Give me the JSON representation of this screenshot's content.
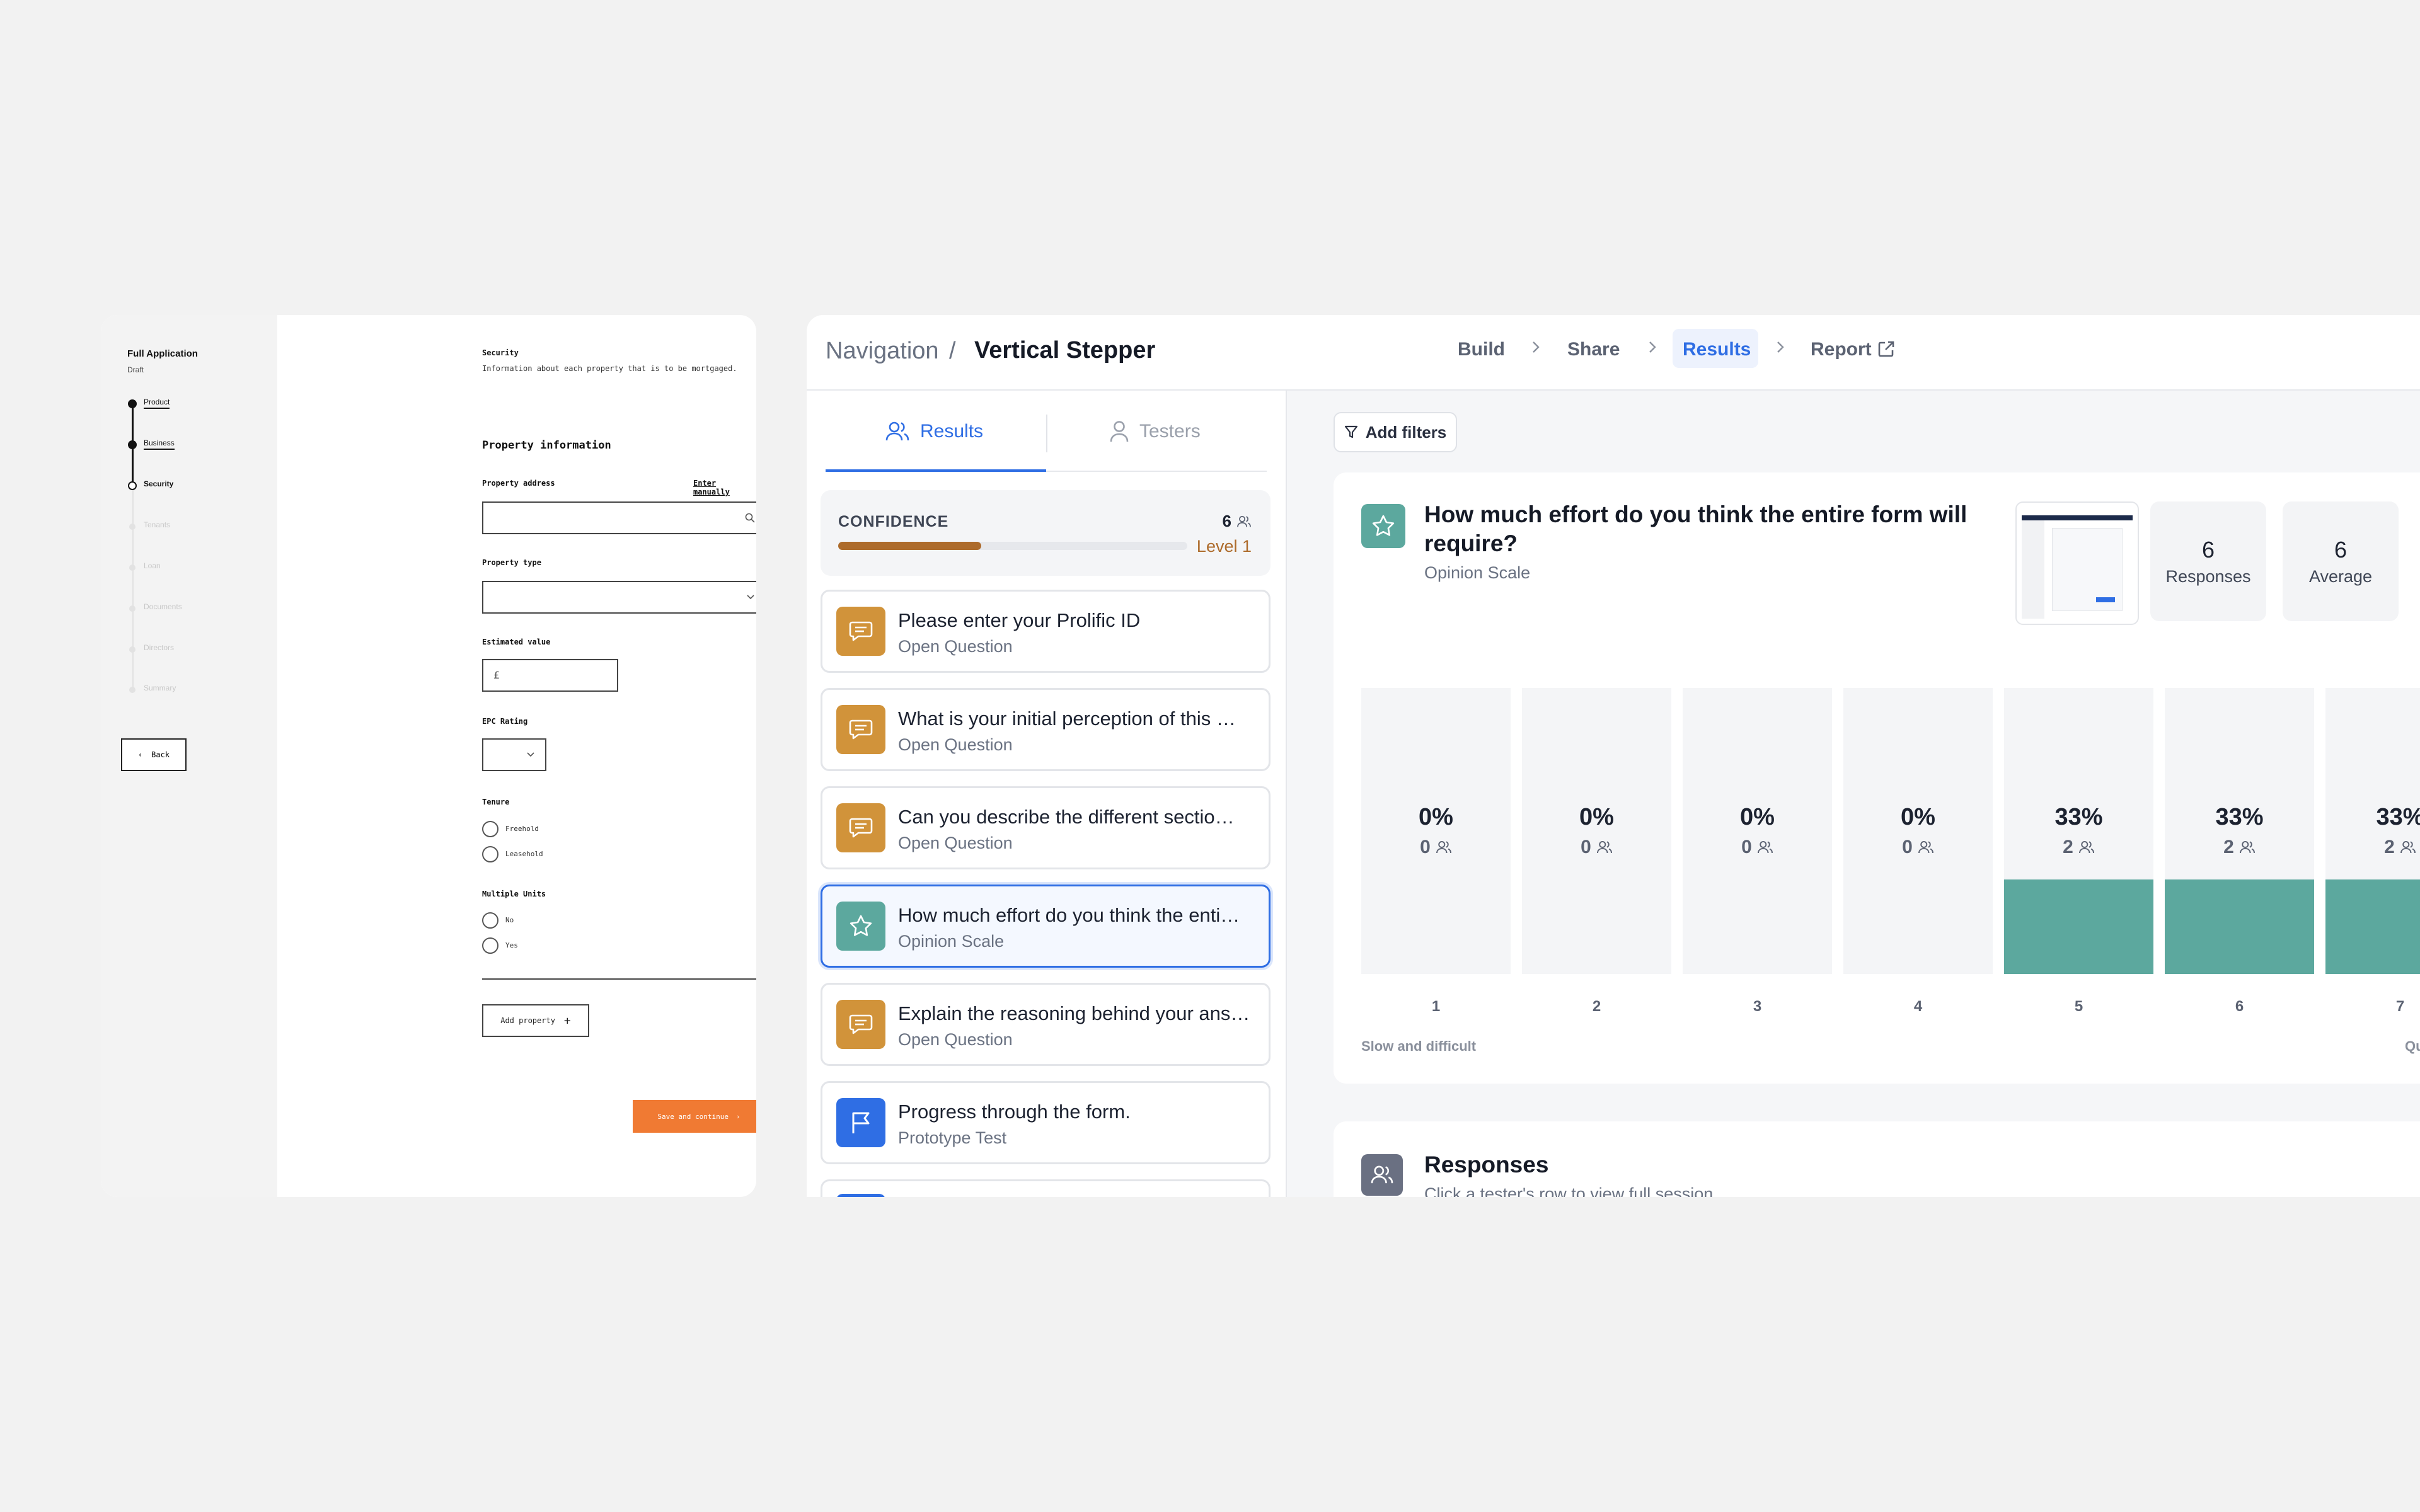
{
  "wireframe": {
    "title": "Full Application",
    "status": "Draft",
    "steps": [
      {
        "label": "Product",
        "state": "done"
      },
      {
        "label": "Business",
        "state": "done"
      },
      {
        "label": "Security",
        "state": "current"
      },
      {
        "label": "Tenants",
        "state": "todo"
      },
      {
        "label": "Loan",
        "state": "todo"
      },
      {
        "label": "Documents",
        "state": "todo"
      },
      {
        "label": "Directors",
        "state": "todo"
      },
      {
        "label": "Summary",
        "state": "todo"
      }
    ],
    "back_label": "Back",
    "section_title": "Security",
    "section_desc": "Information about each property that is to be mortgaged.",
    "heading": "Property information",
    "address_label": "Property address",
    "enter_manually": "Enter manually",
    "type_label": "Property type",
    "value_label": "Estimated value",
    "currency": "£",
    "epc_label": "EPC Rating",
    "tenure_label": "Tenure",
    "tenure_options": [
      "Freehold",
      "Leasehold"
    ],
    "units_label": "Multiple Units",
    "units_options": [
      "No",
      "Yes"
    ],
    "add_property": "Add property",
    "save_continue": "Save and continue"
  },
  "app": {
    "breadcrumb_root": "Navigation",
    "breadcrumb_sep": "/",
    "page_title": "Vertical Stepper",
    "steps": [
      "Build",
      "Share",
      "Results",
      "Report"
    ],
    "active_step": "Results",
    "tabs": {
      "results": "Results",
      "testers": "Testers"
    },
    "confidence": {
      "label": "CONFIDENCE",
      "count": "6",
      "level": "Level 1",
      "progress": 0.41
    },
    "questions": [
      {
        "title": "Please enter your Prolific ID",
        "type": "Open Question",
        "icon": "comment-icon",
        "color": "#d1933a"
      },
      {
        "title": "What is your initial perception of this …",
        "type": "Open Question",
        "icon": "comment-icon",
        "color": "#d1933a"
      },
      {
        "title": "Can you describe the different sectio…",
        "type": "Open Question",
        "icon": "comment-icon",
        "color": "#d1933a"
      },
      {
        "title": "How much effort do you think the enti…",
        "type": "Opinion Scale",
        "icon": "star-icon",
        "color": "#5ca89e"
      },
      {
        "title": "Explain the reasoning behind your ans…",
        "type": "Open Question",
        "icon": "comment-icon",
        "color": "#d1933a"
      },
      {
        "title": "Progress through the form.",
        "type": "Prototype Test",
        "icon": "flag-icon",
        "color": "#2f6ee4"
      }
    ],
    "add_filters": "Add filters",
    "detail": {
      "title": "How much effort do you think the entire form will require?",
      "type": "Opinion Scale",
      "responses_value": "6",
      "responses_label": "Responses",
      "average_value": "6",
      "average_label": "Average",
      "scale_low": "Slow and difficult",
      "scale_high": "Quick a"
    },
    "responses_section": {
      "title": "Responses",
      "subtitle": "Click a tester's row to view full session"
    }
  },
  "chart_data": {
    "type": "bar",
    "categories": [
      "1",
      "2",
      "3",
      "4",
      "5",
      "6",
      "7"
    ],
    "values": [
      0,
      0,
      0,
      0,
      33,
      33,
      33
    ],
    "percent_labels": [
      "0%",
      "0%",
      "0%",
      "0%",
      "33%",
      "33%",
      "33%"
    ],
    "counts": [
      "0",
      "0",
      "0",
      "0",
      "2",
      "2",
      "2"
    ],
    "ylim": [
      0,
      100
    ],
    "color": "#5ca89e"
  }
}
